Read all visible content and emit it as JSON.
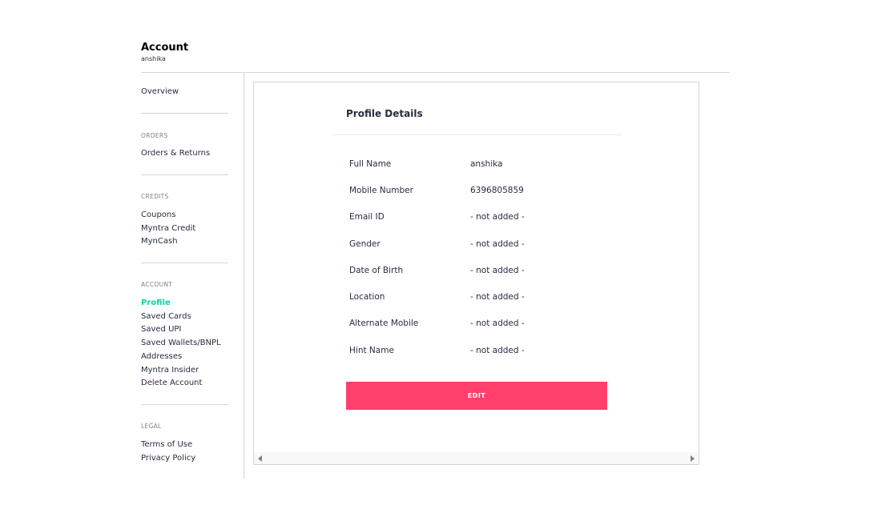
{
  "header": {
    "title": "Account",
    "username": "anshika"
  },
  "sidebar": {
    "overview": "Overview",
    "orders": {
      "heading": "ORDERS",
      "items": [
        "Orders & Returns"
      ]
    },
    "credits": {
      "heading": "CREDITS",
      "items": [
        "Coupons",
        "Myntra Credit",
        "MynCash"
      ]
    },
    "account": {
      "heading": "ACCOUNT",
      "items": [
        "Profile",
        "Saved Cards",
        "Saved UPI",
        "Saved Wallets/BNPL",
        "Addresses",
        "Myntra Insider",
        "Delete Account"
      ],
      "active": "Profile"
    },
    "legal": {
      "heading": "LEGAL",
      "items": [
        "Terms of Use",
        "Privacy Policy"
      ]
    }
  },
  "profile": {
    "title": "Profile Details",
    "rows": [
      {
        "label": "Full Name",
        "value": "anshika"
      },
      {
        "label": "Mobile Number",
        "value": "6396805859"
      },
      {
        "label": "Email ID",
        "value": "- not added -"
      },
      {
        "label": "Gender",
        "value": "- not added -"
      },
      {
        "label": "Date of Birth",
        "value": "- not added -"
      },
      {
        "label": "Location",
        "value": "- not added -"
      },
      {
        "label": "Alternate Mobile",
        "value": "- not added -"
      },
      {
        "label": "Hint Name",
        "value": "- not added -"
      }
    ],
    "edit_label": "EDIT"
  },
  "colors": {
    "accent": "#ff3f6c",
    "active": "#14cda8"
  },
  "icons": {
    "scroll_left": "triangle-left-icon",
    "scroll_right": "triangle-right-icon"
  }
}
